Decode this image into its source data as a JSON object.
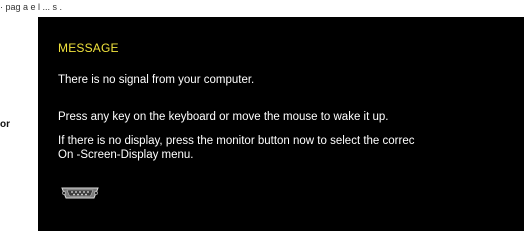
{
  "page": {
    "top_fragment": "· pag  a  e   l ... s .",
    "side_fragment": "or"
  },
  "osd": {
    "title": "MESSAGE",
    "lines": [
      "There is no signal from your computer.",
      "Press any key on the keyboard or move the mouse to wake it up.",
      "If there is no display, press the monitor button now to select the correc",
      "On -Screen-Display menu."
    ],
    "icon": "vga-connector-icon",
    "colors": {
      "panel": "#000000",
      "title": "#f0e23c",
      "text": "#ffffff"
    }
  }
}
